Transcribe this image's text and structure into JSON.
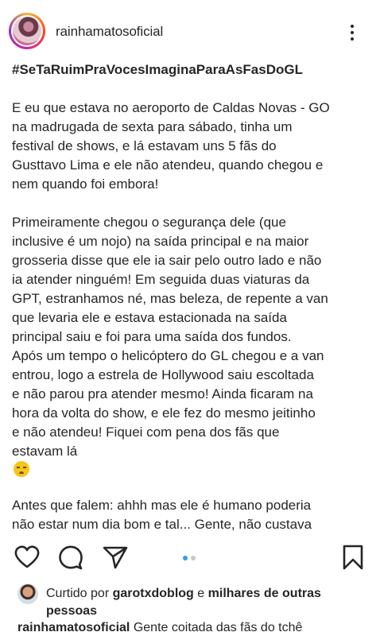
{
  "post": {
    "username": "rainhamatosoficial",
    "hashtag": "#SeTaRuimPraVocesImaginaParaAsFasDoGL",
    "paragraph1": [
      "E eu que estava no aeroporto de Caldas Novas - GO",
      "na madrugada de sexta para sábado, tinha um",
      "festival de shows, e lá estavam uns 5 fãs do",
      "Gusttavo Lima e ele não atendeu, quando chegou e",
      "nem quando foi embora!"
    ],
    "paragraph2": [
      "Primeiramente chegou o segurança dele (que",
      "inclusive é um nojo) na saída principal e na maior",
      "grosseria disse que ele ia sair pelo outro lado e não",
      "ia atender ninguém! Em seguida duas viaturas da",
      "GPT, estranhamos né, mas beleza, de repente a van",
      "que levaria ele e estava estacionada na saída",
      "principal saiu e foi para uma saída dos fundos.",
      "Após um tempo o helicóptero do GL chegou e a van",
      "entrou, logo a estrela de Hollywood saiu escoltada",
      "e não parou pra atender mesmo! Ainda ficaram na",
      "hora da volta do show, e ele fez do mesmo jeitinho",
      "e não atendeu! Fiquei com pena dos fãs que",
      "estavam lá"
    ],
    "paragraph3": [
      "Antes que falem: ahhh mas ele é humano poderia",
      "não estar num dia bom e tal... Gente, não custava"
    ],
    "emoji_icon": "sleepy-face-emoji"
  },
  "actions": {
    "like_icon": "heart-outline-icon",
    "comment_icon": "comment-bubble-icon",
    "share_icon": "paper-plane-icon",
    "save_icon": "bookmark-outline-icon",
    "carousel": {
      "count": 2,
      "active": 1
    }
  },
  "likes": {
    "prefix": "Curtido por",
    "liker": "garotxdoblog",
    "connector": "e",
    "others": "milhares de outras",
    "others_line2": "pessoas"
  },
  "comment": {
    "username": "rainhamatosoficial",
    "text": "Gente coitada das fãs do tchê"
  },
  "colors": {
    "text": "#262626",
    "carousel_active": "#3897f0",
    "carousel_inactive": "#c7c7c7"
  }
}
